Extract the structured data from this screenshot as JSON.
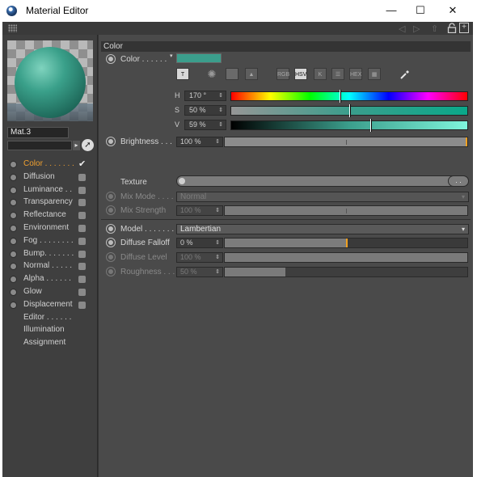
{
  "window": {
    "title": "Material Editor",
    "minimize": "—",
    "maximize": "☐",
    "close": "✕"
  },
  "toolbar": {
    "back": "◁",
    "forward": "▷",
    "up": "⇧"
  },
  "material": {
    "name": "Mat.3"
  },
  "channels": [
    {
      "label": "Color . . . . . . .",
      "enabled": true,
      "active": true
    },
    {
      "label": "Diffusion",
      "enabled": false
    },
    {
      "label": "Luminance . .",
      "enabled": false
    },
    {
      "label": "Transparency",
      "enabled": false
    },
    {
      "label": "Reflectance",
      "enabled": false
    },
    {
      "label": "Environment",
      "enabled": false
    },
    {
      "label": "Fog . . . . . . . .",
      "enabled": false
    },
    {
      "label": "Bump. . . . . . .",
      "enabled": false
    },
    {
      "label": "Normal . . . . .",
      "enabled": false
    },
    {
      "label": "Alpha . . . . . .",
      "enabled": false
    },
    {
      "label": "Glow",
      "enabled": false
    },
    {
      "label": "Displacement",
      "enabled": false
    },
    {
      "label": "Editor . . . . . .",
      "enabled": null
    },
    {
      "label": "Illumination",
      "enabled": null
    },
    {
      "label": "Assignment",
      "enabled": null
    }
  ],
  "color_section": {
    "heading": "Color",
    "color_label": "Color . . . . . .",
    "swatch_color": "#3b9e8c",
    "modes": [
      "RGB",
      "HSV",
      "K",
      "",
      "HEX",
      ""
    ],
    "active_mode": "HSV",
    "h": {
      "letter": "H",
      "value": "170 °",
      "position": 0.47
    },
    "s": {
      "letter": "S",
      "value": "50 %",
      "position": 0.5
    },
    "v": {
      "letter": "V",
      "value": "59 %",
      "position": 0.59
    },
    "brightness": {
      "label": "Brightness . . .",
      "value": "100 %",
      "level": 1.0
    },
    "texture": {
      "label": "Texture",
      "button": ". ."
    },
    "mix_mode": {
      "label": "Mix Mode . . . .",
      "value": "Normal"
    },
    "mix_strength": {
      "label": "Mix Strength",
      "value": "100 %",
      "level": 1.0
    },
    "model": {
      "label": "Model . . . . . . .",
      "value": "Lambertian"
    },
    "diffuse_falloff": {
      "label": "Diffuse Falloff",
      "value": "0 %",
      "level": 0.5
    },
    "diffuse_level": {
      "label": "Diffuse Level",
      "value": "100 %",
      "level": 1.0
    },
    "roughness": {
      "label": "Roughness . . .",
      "value": "50 %",
      "level": 0.25
    }
  },
  "colors": {
    "accent": "#f0a030",
    "panel": "#4a4a4a"
  }
}
